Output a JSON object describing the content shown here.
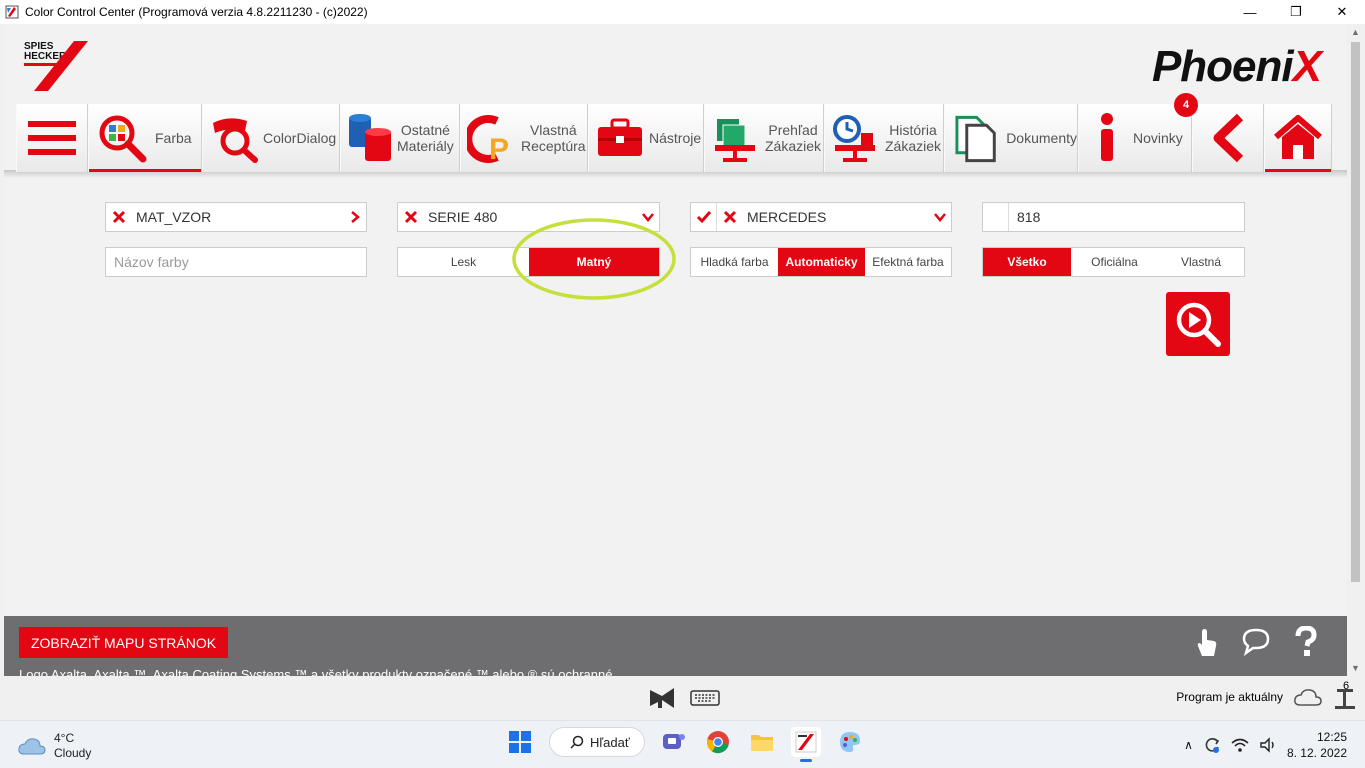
{
  "window": {
    "title": "Color Control Center (Programová verzia 4.8.2211230 - (c)2022)",
    "minimize": "—",
    "maximize": "❐",
    "close": "✕"
  },
  "brand": {
    "logo_line1": "SPIES",
    "logo_line2": "HECKER",
    "product_main": "Phoeni",
    "product_x": "X"
  },
  "nav": {
    "farba": "Farba",
    "colordialog": "ColorDialog",
    "ostatne_1": "Ostatné",
    "ostatne_2": "Materiály",
    "vlastna_1": "Vlastná",
    "vlastna_2": "Receptúra",
    "nastroje": "Nástroje",
    "prehlad_1": "Prehľad",
    "prehlad_2": "Zákaziek",
    "historia_1": "História",
    "historia_2": "Zákaziek",
    "dokumenty": "Dokumenty",
    "novinky": "Novinky",
    "novinky_badge": "4"
  },
  "filters": {
    "mat_vzor": "MAT_VZOR",
    "serie": "SERIE 480",
    "manufacturer": "MERCEDES",
    "code": "818",
    "name_placeholder": "Názov farby"
  },
  "gloss": {
    "lesk": "Lesk",
    "matny": "Matný",
    "selected": "Matný"
  },
  "effect": {
    "hladka": "Hladká farba",
    "auto": "Automaticky",
    "efektna": "Efektná farba",
    "selected": "Automaticky"
  },
  "source": {
    "vsetko": "Všetko",
    "oficialna": "Oficiálna",
    "vlastna": "Vlastná",
    "selected": "Všetko"
  },
  "footer": {
    "map_button": "ZOBRAZIŤ MAPU STRÁNOK",
    "legal": "Logo Axalta, Axalta ™, Axalta Coating Systems ™ a všetky produkty označené ™ alebo ® sú ochranné"
  },
  "statusbar": {
    "program_status": "Program je aktuálny",
    "counter": "6"
  },
  "taskbar": {
    "temperature": "4°C",
    "condition": "Cloudy",
    "search": "Hľadať",
    "time": "12:25",
    "date": "8. 12. 2022"
  },
  "colors": {
    "accent": "#e30613",
    "highlight_circle": "#c5e03a",
    "footer_bg": "#6e6e70"
  }
}
